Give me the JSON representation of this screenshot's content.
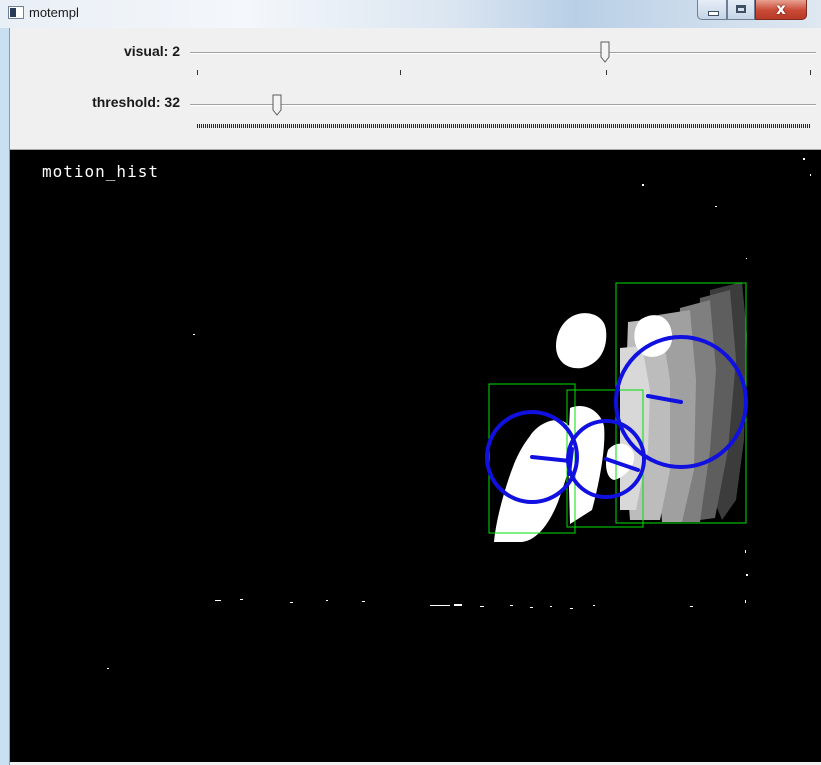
{
  "window": {
    "title": "motempl",
    "controls": {
      "minimize_icon": "minimize-icon",
      "maximize_icon": "maximize-icon",
      "close_icon": "close-icon",
      "close_glyph": "x"
    }
  },
  "trackbars": [
    {
      "label": "visual: 2",
      "value": 2,
      "max": 3,
      "tick_style": "sparse",
      "tick_count": 4
    },
    {
      "label": "threshold: 32",
      "value": 32,
      "max": 255,
      "tick_style": "dense"
    }
  ],
  "image": {
    "overlay_text": "motion_hist",
    "background": "#000000",
    "colors": {
      "motion_blob": "#ffffff",
      "bounding_box": "#00e000",
      "orientation_circle": "#1010e0"
    },
    "motion_components": 3
  }
}
